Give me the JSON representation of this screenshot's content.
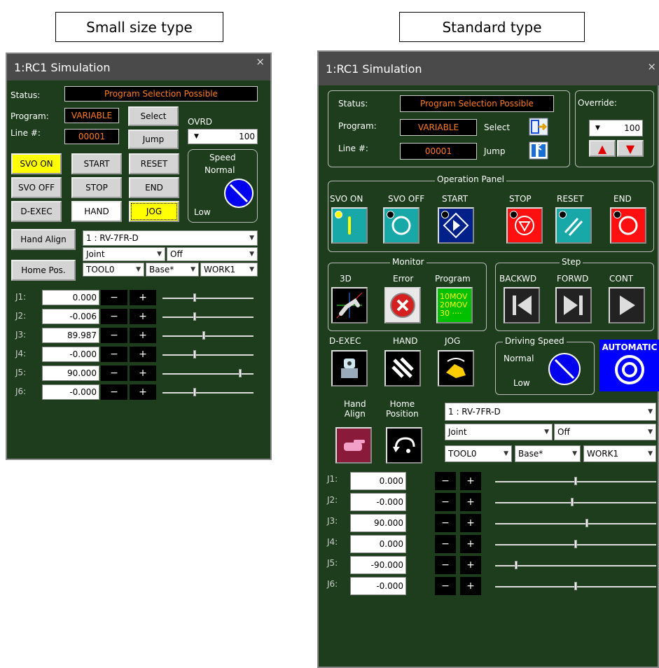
{
  "captions": {
    "small": "Small size type",
    "standard": "Standard type"
  },
  "small": {
    "title": "1:RC1  Simulation",
    "close": "×",
    "status_label": "Status:",
    "status_value": "Program Selection Possible",
    "program_label": "Program:",
    "program_value": "VARIABLE",
    "line_label": "Line #:",
    "line_value": "00001",
    "select_btn": "Select",
    "jump_btn": "Jump",
    "ovrd_label": "OVRD",
    "ovrd_value": "100",
    "speed_label": "Speed",
    "speed_normal": "Normal",
    "speed_low": "Low",
    "buttons": {
      "svo_on": "SVO ON",
      "start": "START",
      "reset": "RESET",
      "svo_off": "SVO OFF",
      "stop": "STOP",
      "end": "END",
      "dexec": "D-EXEC",
      "hand": "HAND",
      "jog": "JOG"
    },
    "hand_align": "Hand Align",
    "home_pos": "Home Pos.",
    "robot": "1 : RV-7FR-D",
    "jog_mode": "Joint",
    "off": "Off",
    "tool": "TOOL0",
    "base": "Base*",
    "work": "WORK1",
    "joints": [
      {
        "name": "J1:",
        "value": "0.000",
        "pos": 0.35
      },
      {
        "name": "J2:",
        "value": "-0.006",
        "pos": 0.35
      },
      {
        "name": "J3:",
        "value": "89.987",
        "pos": 0.45
      },
      {
        "name": "J4:",
        "value": "-0.000",
        "pos": 0.35
      },
      {
        "name": "J5:",
        "value": "90.000",
        "pos": 0.85
      },
      {
        "name": "J6:",
        "value": "-0.000",
        "pos": 0.35
      }
    ],
    "minus": "−",
    "plus": "+"
  },
  "standard": {
    "title": "1:RC1  Simulation",
    "close": "×",
    "status_label": "Status:",
    "status_value": "Program Selection Possible",
    "program_label": "Program:",
    "program_value": "VARIABLE",
    "line_label": "Line #:",
    "line_value": "00001",
    "select_label": "Select",
    "jump_label": "Jump",
    "override_label": "Override:",
    "override_value": "100",
    "operation_panel": "Operation Panel",
    "ops": {
      "svo_on": "SVO ON",
      "svo_off": "SVO OFF",
      "start": "START",
      "stop": "STOP",
      "reset": "RESET",
      "end": "END"
    },
    "monitor": "Monitor",
    "mon": {
      "d3": "3D",
      "error": "Error",
      "program": "Program"
    },
    "program_icon_lines": [
      "10MOV",
      "20MOV",
      "30 ····"
    ],
    "step": "Step",
    "steps": {
      "backwd": "BACKWD",
      "forwd": "FORWD",
      "cont": "CONT"
    },
    "dexec": "D-EXEC",
    "hand": "HAND",
    "jog": "JOG",
    "driving_speed": "Driving Speed",
    "speed_normal": "Normal",
    "speed_low": "Low",
    "automatic": "AUTOMATIC",
    "hand_align": [
      "Hand",
      "Align"
    ],
    "home_position": [
      "Home",
      "Position"
    ],
    "robot": "1 : RV-7FR-D",
    "jog_mode": "Joint",
    "off": "Off",
    "tool": "TOOL0",
    "base": "Base*",
    "work": "WORK1",
    "joints": [
      {
        "name": "J1:",
        "value": "0.000",
        "pos": 0.5
      },
      {
        "name": "J2:",
        "value": "-0.000",
        "pos": 0.48
      },
      {
        "name": "J3:",
        "value": "90.000",
        "pos": 0.57
      },
      {
        "name": "J4:",
        "value": "0.000",
        "pos": 0.5
      },
      {
        "name": "J5:",
        "value": "-90.000",
        "pos": 0.13
      },
      {
        "name": "J6:",
        "value": "-0.000",
        "pos": 0.5
      }
    ],
    "minus": "−",
    "plus": "+"
  },
  "colors": {
    "panel_bg": "#1d3d1d",
    "status_text": "#ff7a1a",
    "yellow": "#ffff00",
    "automatic_bg": "#0000ff"
  }
}
